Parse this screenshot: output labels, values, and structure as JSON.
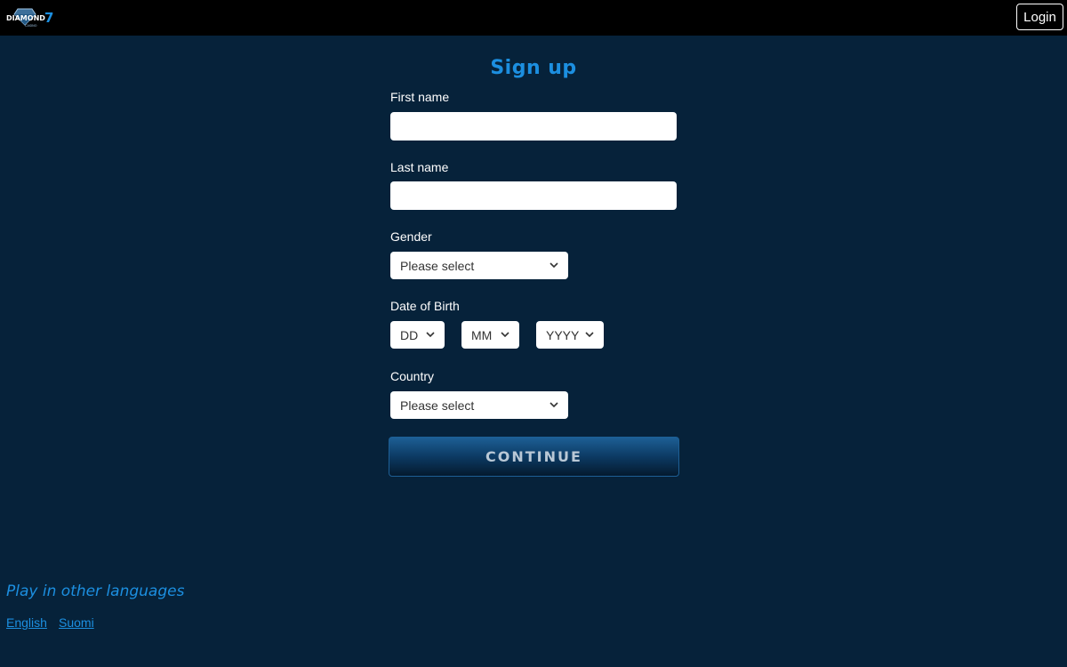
{
  "header": {
    "logo_text": "DIAMOND 7",
    "logo_subtext": "CASINO",
    "login_label": "Login"
  },
  "form": {
    "title": "Sign up",
    "first_name": {
      "label": "First name",
      "value": ""
    },
    "last_name": {
      "label": "Last name",
      "value": ""
    },
    "gender": {
      "label": "Gender",
      "selected": "Please select"
    },
    "dob": {
      "label": "Date of Birth",
      "day": "DD",
      "month": "MM",
      "year": "YYYY"
    },
    "country": {
      "label": "Country",
      "selected": "Please select"
    },
    "continue_label": "CONTINUE"
  },
  "footer": {
    "languages_heading": "Play in other languages",
    "languages": [
      "English",
      "Suomi"
    ]
  },
  "colors": {
    "background": "#06223a",
    "topbar": "#000000",
    "accent": "#1c8fe0"
  }
}
